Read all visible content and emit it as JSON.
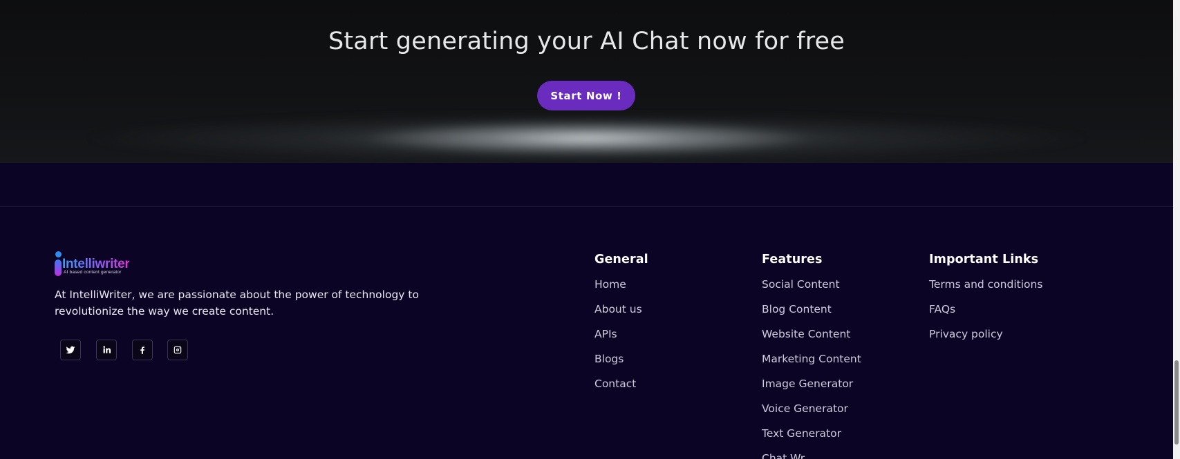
{
  "hero": {
    "title": "Start generating your AI Chat now for free",
    "cta_label": "Start Now !"
  },
  "footer": {
    "logo": {
      "wordmark": "Intelliwriter",
      "tagline": "AI based content generator"
    },
    "about": "At IntelliWriter, we are passionate about the power of technology to revolutionize the way we create content.",
    "social": [
      "twitter-icon",
      "linkedin-icon",
      "facebook-icon",
      "instagram-icon"
    ],
    "columns": [
      {
        "title": "General",
        "links": [
          "Home",
          "About us",
          "APIs",
          "Blogs",
          "Contact"
        ]
      },
      {
        "title": "Features",
        "links": [
          "Social Content",
          "Blog Content",
          "Website Content",
          "Marketing Content",
          "Image Generator",
          "Voice Generator",
          "Text Generator",
          "Chat Wr..."
        ]
      },
      {
        "title": "Important Links",
        "links": [
          "Terms and conditions",
          "FAQs",
          "Privacy policy"
        ]
      }
    ]
  },
  "colors": {
    "page_bg": "#0c0424",
    "accent": "#6a2bbf",
    "hero_bg": "#111214"
  }
}
